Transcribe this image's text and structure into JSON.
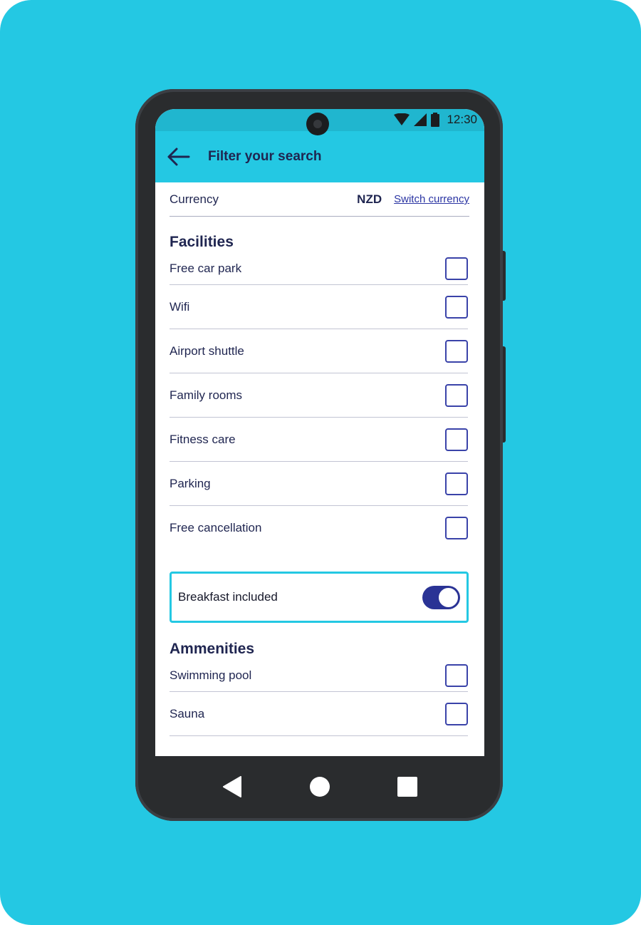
{
  "status_bar": {
    "time": "12:30"
  },
  "app_bar": {
    "title": "Filter your search",
    "back_icon": "arrow-left-icon"
  },
  "currency": {
    "label": "Currency",
    "code": "NZD",
    "switch_link": "Switch currency"
  },
  "facilities": {
    "title": "Facilities",
    "items": [
      {
        "label": "Free car park",
        "checked": false
      },
      {
        "label": "Wifi",
        "checked": false
      },
      {
        "label": "Airport shuttle",
        "checked": false
      },
      {
        "label": "Family rooms",
        "checked": false
      },
      {
        "label": "Fitness care",
        "checked": false
      },
      {
        "label": "Parking",
        "checked": false
      },
      {
        "label": "Free cancellation",
        "checked": false
      }
    ]
  },
  "breakfast": {
    "label": "Breakfast included",
    "on": true
  },
  "ammenities": {
    "title": "Ammenities",
    "items": [
      {
        "label": "Swimming pool",
        "checked": false
      },
      {
        "label": "Sauna",
        "checked": false
      }
    ]
  },
  "nav": {
    "back": "nav-back-icon",
    "home": "nav-home-icon",
    "recents": "nav-recents-icon"
  },
  "colors": {
    "background": "#24c8e3",
    "primary": "#2a3395",
    "text": "#1f2550"
  }
}
